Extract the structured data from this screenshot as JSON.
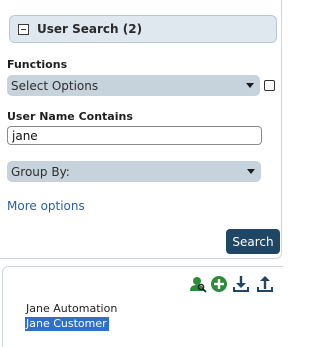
{
  "header": {
    "title": "User Search (2)"
  },
  "functions": {
    "label": "Functions",
    "selected": "Select Options",
    "checked": false
  },
  "username": {
    "label": "User Name Contains",
    "value": "jane"
  },
  "group_by": {
    "selected": "Group By:"
  },
  "links": {
    "more_options": "More options"
  },
  "buttons": {
    "search": "Search"
  },
  "toolbar_icons": [
    "user-search-icon",
    "add-icon",
    "download-icon",
    "upload-icon"
  ],
  "colors": {
    "accent": "#1f4664",
    "select_bg": "#c6d2dc",
    "header_bg": "#dfe8ef",
    "selection": "#2f6fc9",
    "icon_green": "#2e8b3a",
    "link": "#2d5f9a"
  },
  "results": [
    {
      "name": "Jane Automation",
      "selected": false
    },
    {
      "name": "Jane Customer",
      "selected": true
    }
  ]
}
